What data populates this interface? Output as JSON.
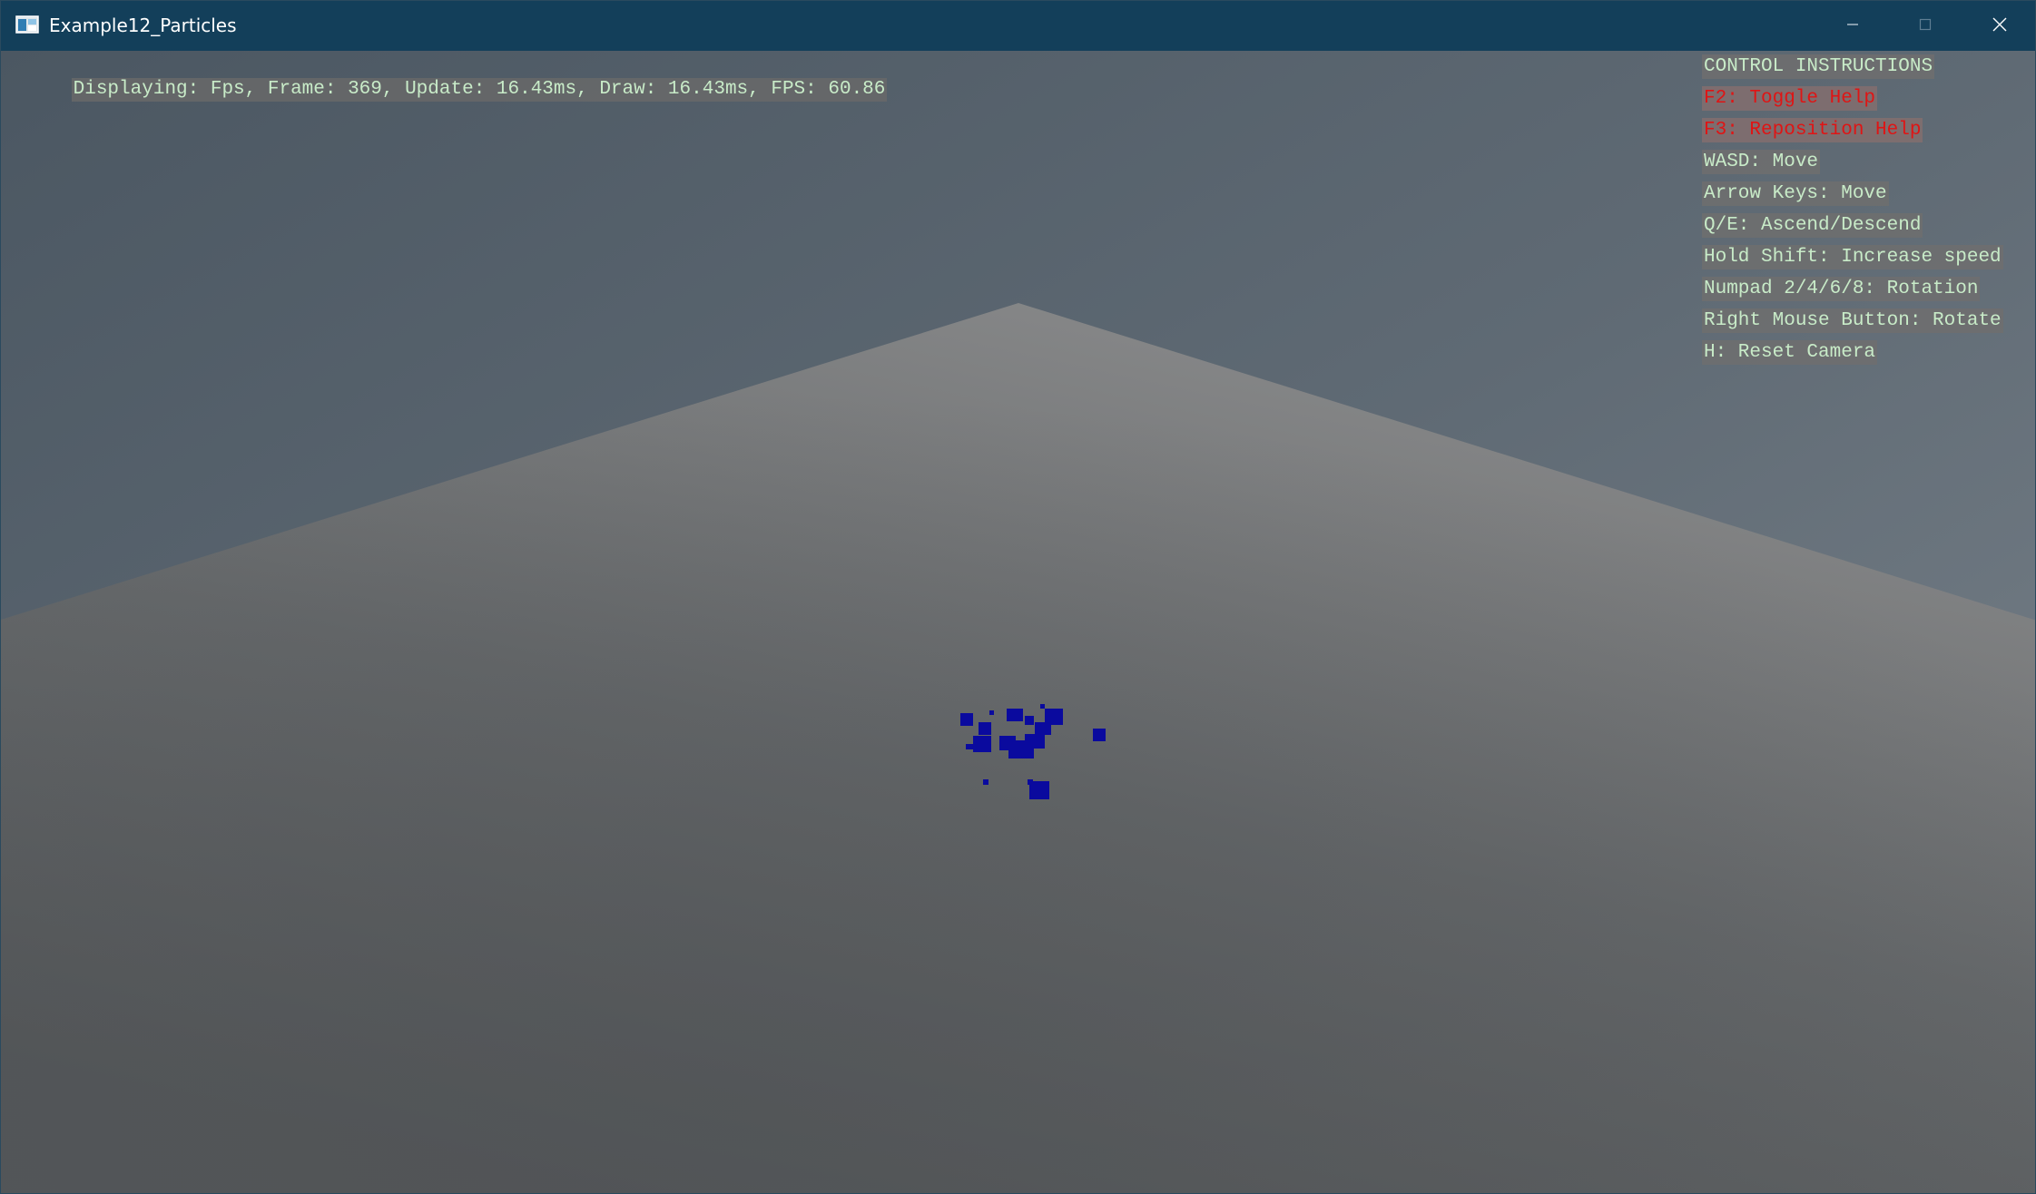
{
  "window": {
    "title": "Example12_Particles",
    "icons": {
      "app": "app-window-icon",
      "minimize": "minimize-icon",
      "maximize": "maximize-icon",
      "close": "close-icon"
    }
  },
  "hud": {
    "stats": "Displaying: Fps, Frame: 369, Update: 16.43ms, Draw: 16.43ms, FPS: 60.86"
  },
  "help": {
    "lines": [
      {
        "text": "CONTROL INSTRUCTIONS",
        "color": "#c8ebc8"
      },
      {
        "text": "F2: Toggle Help",
        "color": "#e01414"
      },
      {
        "text": "F3: Reposition Help",
        "color": "#e01414"
      },
      {
        "text": "WASD: Move",
        "color": "#c8ebc8"
      },
      {
        "text": "Arrow Keys: Move",
        "color": "#c8ebc8"
      },
      {
        "text": "Q/E: Ascend/Descend",
        "color": "#c8ebc8"
      },
      {
        "text": "Hold Shift: Increase speed",
        "color": "#c8ebc8"
      },
      {
        "text": "Numpad 2/4/6/8: Rotation",
        "color": "#c8ebc8"
      },
      {
        "text": "Right Mouse Button: Rotate",
        "color": "#c8ebc8"
      },
      {
        "text": "H: Reset Camera",
        "color": "#c8ebc8"
      }
    ]
  },
  "scene": {
    "particle_color": "#0a0a9e",
    "floor_color": "#7a7a7a"
  }
}
